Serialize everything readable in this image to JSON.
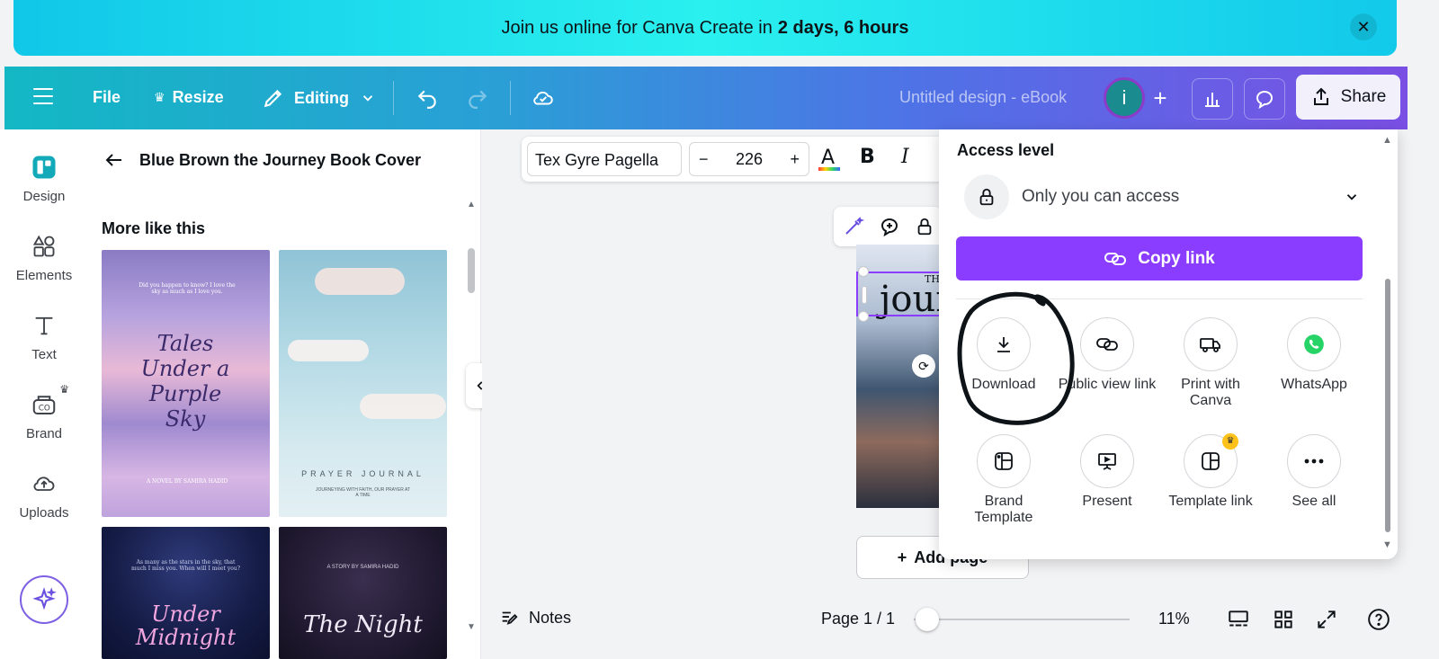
{
  "banner": {
    "text": "Join us online for Canva Create in",
    "highlight": "2 days, 6 hours",
    "close_icon": "close-icon"
  },
  "topbar": {
    "file_label": "File",
    "resize_label": "Resize",
    "editing_label": "Editing",
    "design_title": "Untitled design - eBook",
    "avatar_letter": "i",
    "share_label": "Share"
  },
  "rail": {
    "items": [
      {
        "label": "Design",
        "icon": "design-icon"
      },
      {
        "label": "Elements",
        "icon": "elements-icon"
      },
      {
        "label": "Text",
        "icon": "text-icon"
      },
      {
        "label": "Brand",
        "icon": "brand-icon"
      },
      {
        "label": "Uploads",
        "icon": "uploads-icon"
      }
    ]
  },
  "panel": {
    "title": "Blue Brown the Journey Book Cover",
    "section": "More like this",
    "templates": [
      {
        "title": "Tales Under a Purple Sky",
        "top_text": "Did you happen to know? I love the sky as much as I love you.",
        "bottom_text": "A NOVEL BY SAMIRA HADID"
      },
      {
        "title": "PRAYER JOURNAL",
        "subtitle": "JOURNEYING WITH FAITH, OUR PRAYER AT A TIME"
      },
      {
        "title": "Under Midnight",
        "top_text": "As many as the stars in the sky, that much I miss you. When will I meet you?"
      },
      {
        "title": "The Night",
        "top_text": "A STORY BY SAMIRA HADID"
      }
    ]
  },
  "toolbar": {
    "font_name": "Tex Gyre Pagella",
    "font_size": "226",
    "minus": "−",
    "plus": "+",
    "bold": "B",
    "italic": "I"
  },
  "canvas": {
    "cover_text": "journ",
    "cover_small": "TH",
    "add_page_label": "Add page"
  },
  "bottom": {
    "notes_label": "Notes",
    "page_indicator": "Page 1 / 1",
    "zoom": "11%",
    "zoom_fraction": 0.01
  },
  "share_popup": {
    "access_title": "Access level",
    "access_value": "Only you can access",
    "copy_link_label": "Copy link",
    "options": [
      {
        "label": "Download",
        "icon": "download-icon"
      },
      {
        "label": "Public view link",
        "icon": "link-icon"
      },
      {
        "label": "Print with Canva",
        "icon": "truck-icon"
      },
      {
        "label": "WhatsApp",
        "icon": "whatsapp-icon"
      },
      {
        "label": "Brand Template",
        "icon": "brand-template-icon"
      },
      {
        "label": "Present",
        "icon": "present-icon"
      },
      {
        "label": "Template link",
        "icon": "template-link-icon"
      },
      {
        "label": "See all",
        "icon": "more-icon"
      }
    ]
  },
  "colors": {
    "accent": "#8b3dff",
    "whatsapp": "#25d366"
  }
}
